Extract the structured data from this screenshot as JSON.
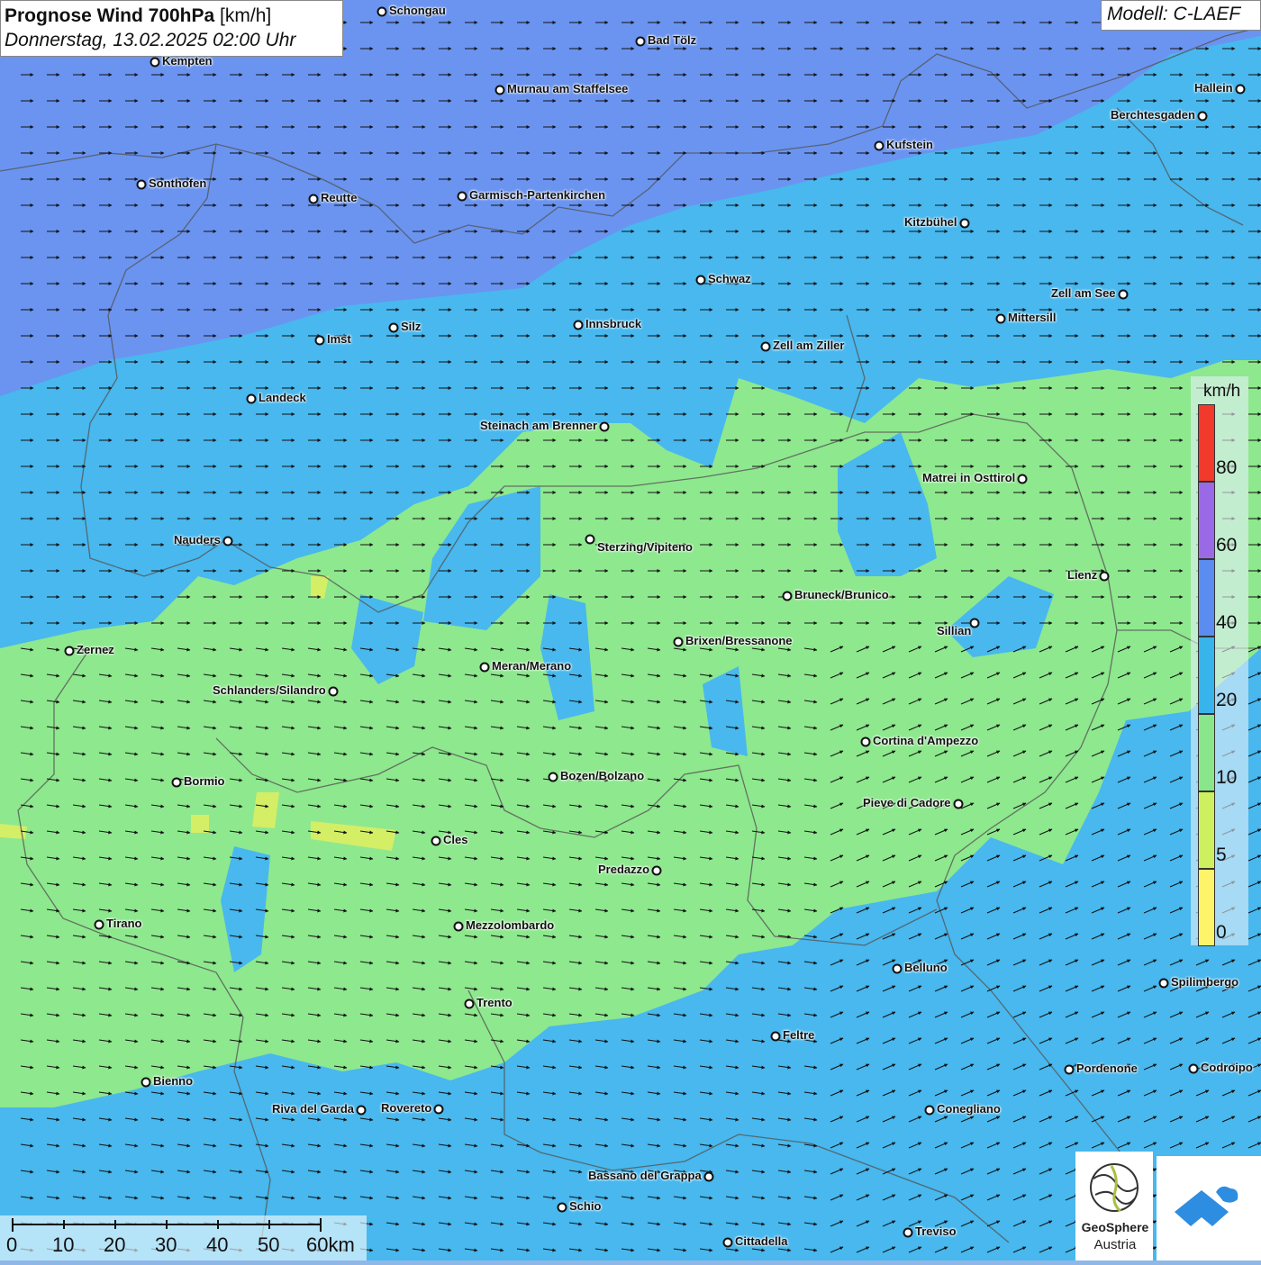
{
  "header": {
    "title_bold": "Prognose Wind 700hPa",
    "title_unit": "[km/h]",
    "datetime": "Donnerstag, 13.02.2025 02:00 Uhr",
    "model": "Modell: C-LAEF"
  },
  "legend": {
    "unit": "km/h",
    "ticks": [
      "80",
      "60",
      "40",
      "20",
      "10",
      "5",
      "0"
    ],
    "colors": {
      "c80": "#f23a2c",
      "c60": "#9a6ae6",
      "c40": "#5b8cf0",
      "c20": "#38b4ec",
      "c10": "#8ae68a",
      "c5": "#ccf060",
      "c0": "#fdf46a"
    }
  },
  "scale": {
    "labels": [
      "0",
      "10",
      "20",
      "30",
      "40",
      "50",
      "60km"
    ]
  },
  "logo": {
    "name": "GeoSphere",
    "country": "Austria"
  },
  "cities": [
    {
      "name": "Schongau"
    },
    {
      "name": "Bad Tölz"
    },
    {
      "name": "Kempten"
    },
    {
      "name": "Murnau am Staffelsee"
    },
    {
      "name": "Hallein"
    },
    {
      "name": "Berchtesgaden"
    },
    {
      "name": "Kufstein"
    },
    {
      "name": "Sonthofen"
    },
    {
      "name": "Reutte"
    },
    {
      "name": "Garmisch-Partenkirchen"
    },
    {
      "name": "Kitzbühel"
    },
    {
      "name": "Schwaz"
    },
    {
      "name": "Zell am See"
    },
    {
      "name": "Mittersill"
    },
    {
      "name": "Innsbruck"
    },
    {
      "name": "Silz"
    },
    {
      "name": "Imst"
    },
    {
      "name": "Zell am Ziller"
    },
    {
      "name": "Landeck"
    },
    {
      "name": "Steinach am Brenner"
    },
    {
      "name": "Matrei in Osttirol"
    },
    {
      "name": "Nauders"
    },
    {
      "name": "Sterzing/Vipiteno"
    },
    {
      "name": "Lienz"
    },
    {
      "name": "Bruneck/Brunico"
    },
    {
      "name": "Sillian"
    },
    {
      "name": "Brixen/Bressanone"
    },
    {
      "name": "Zernez"
    },
    {
      "name": "Meran/Merano"
    },
    {
      "name": "Schlanders/Silandro"
    },
    {
      "name": "Cortina d'Ampezzo"
    },
    {
      "name": "Bozen/Bolzano"
    },
    {
      "name": "Bormio"
    },
    {
      "name": "Pieve di Cadore"
    },
    {
      "name": "Cles"
    },
    {
      "name": "Predazzo"
    },
    {
      "name": "Tirano"
    },
    {
      "name": "Mezzolombardo"
    },
    {
      "name": "Belluno"
    },
    {
      "name": "Spilimbergo"
    },
    {
      "name": "Trento"
    },
    {
      "name": "Feltre"
    },
    {
      "name": "Pordenone"
    },
    {
      "name": "Codroipo"
    },
    {
      "name": "Bienno"
    },
    {
      "name": "Riva del Garda"
    },
    {
      "name": "Rovereto"
    },
    {
      "name": "Conegliano"
    },
    {
      "name": "Bassano del Grappa"
    },
    {
      "name": "Schio"
    },
    {
      "name": "Treviso"
    },
    {
      "name": "Cittadella"
    }
  ]
}
